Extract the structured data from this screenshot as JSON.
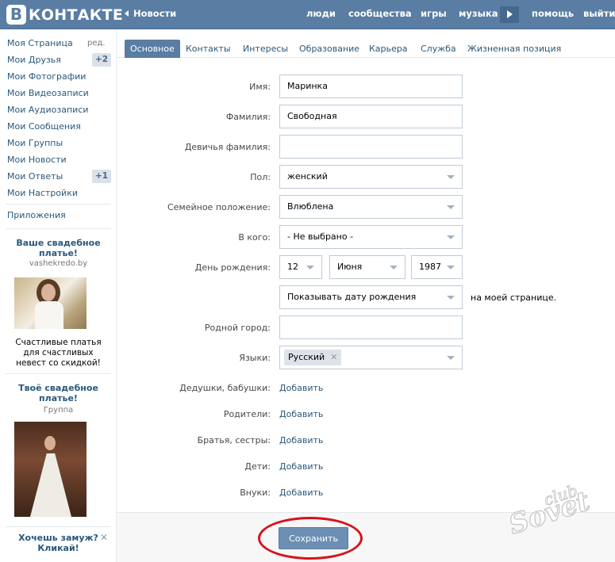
{
  "header": {
    "logo_letter": "В",
    "logo_text": "КОНТАКТЕ",
    "news": "Новости",
    "links": [
      "люди",
      "сообщества",
      "игры",
      "музыка",
      "помощь",
      "выйти"
    ]
  },
  "sidebar": {
    "items": [
      {
        "label": "Моя Страница",
        "aux": "ред."
      },
      {
        "label": "Мои Друзья",
        "badge": "+2"
      },
      {
        "label": "Мои Фотографии"
      },
      {
        "label": "Мои Видеозаписи"
      },
      {
        "label": "Мои Аудиозаписи"
      },
      {
        "label": "Мои Сообщения"
      },
      {
        "label": "Мои Группы"
      },
      {
        "label": "Мои Новости"
      },
      {
        "label": "Мои Ответы",
        "badge": "+1"
      },
      {
        "label": "Мои Настройки"
      }
    ],
    "apps": "Приложения",
    "ads": [
      {
        "title": "Ваше свадебное платье!",
        "sub": "vashekredo.by",
        "text": "Счастливые платья для счастливых невест со скидкой!"
      },
      {
        "title": "Твоё свадебное платье!",
        "sub": "Группа"
      },
      {
        "title": "Хочешь замуж? Кликай!"
      }
    ]
  },
  "tabs": [
    "Основное",
    "Контакты",
    "Интересы",
    "Образование",
    "Карьера",
    "Служба",
    "Жизненная позиция"
  ],
  "form": {
    "labels": {
      "first_name": "Имя:",
      "last_name": "Фамилия:",
      "maiden_name": "Девичья фамилия:",
      "gender": "Пол:",
      "relationship": "Семейное положение:",
      "partner": "В кого:",
      "birthday": "День рождения:",
      "hometown": "Родной город:",
      "languages": "Языки:",
      "grandparents": "Дедушки, бабушки:",
      "parents": "Родители:",
      "siblings": "Братья, сестры:",
      "children": "Дети:",
      "grandchildren": "Внуки:"
    },
    "values": {
      "first_name": "Маринка",
      "last_name": "Свободная",
      "maiden_name": "",
      "gender": "женский",
      "relationship": "Влюблена",
      "partner": "- Не выбрано -",
      "birth_day": "12",
      "birth_month": "Июня",
      "birth_year": "1987",
      "birthday_visibility": "Показывать дату рождения",
      "birthday_note": "на моей странице.",
      "hometown": "",
      "language_chip": "Русский"
    },
    "add_label": "Добавить",
    "save": "Сохранить"
  },
  "watermark": "club Sovet",
  "colors": {
    "header": "#597da3",
    "link": "#2b587a",
    "button": "#6d8fb3",
    "highlight": "#d7121b"
  }
}
